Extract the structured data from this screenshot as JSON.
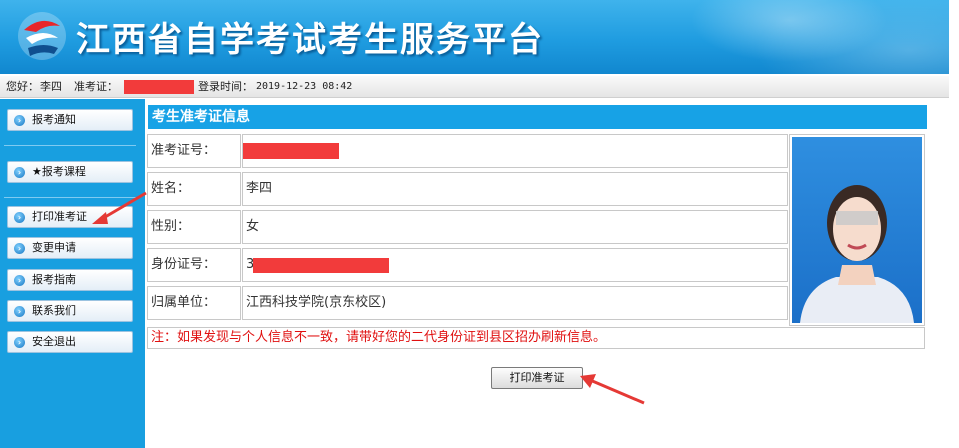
{
  "header": {
    "title": "江西省自学考试考生服务平台",
    "logo_icon": "exam-logo-icon"
  },
  "infobar": {
    "greeting_label": "您好：",
    "user_name": "李四",
    "ticket_label": "准考证：",
    "login_time_label": "登录时间：",
    "login_time": "2019-12-23 08:42"
  },
  "sidebar": {
    "items": [
      {
        "label": "报考通知"
      },
      {
        "label": "★报考课程"
      },
      {
        "label": "打印准考证"
      },
      {
        "label": "变更申请"
      },
      {
        "label": "报考指南"
      },
      {
        "label": "联系我们"
      },
      {
        "label": "安全退出"
      }
    ]
  },
  "main": {
    "section_title": "考生准考证信息",
    "rows": [
      {
        "label": "准考证号：",
        "value": ""
      },
      {
        "label": "姓名：",
        "value": "李四"
      },
      {
        "label": "性别：",
        "value": "女"
      },
      {
        "label": "身份证号：",
        "value": "3"
      },
      {
        "label": "归属单位：",
        "value": "江西科技学院(京东校区)"
      }
    ],
    "notice": "注：如果发现与个人信息不一致，请带好您的二代身份证到县区招办刷新信息。",
    "print_button": "打印准考证"
  },
  "colors": {
    "banner": "#1f9ce0",
    "sidebar": "#189fe0",
    "section_title_bg": "#17a2e6",
    "notice_text": "#e01010",
    "redaction": "#f23b3b",
    "annotation_arrow": "#e53935"
  }
}
